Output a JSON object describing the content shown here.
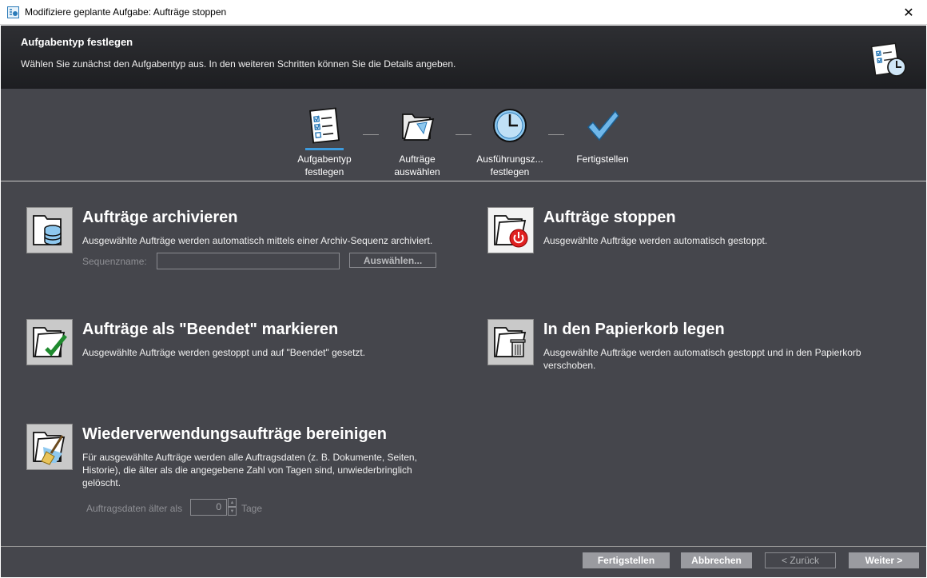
{
  "window": {
    "title": "Modifiziere geplante Aufgabe: Aufträge stoppen",
    "close_glyph": "✕"
  },
  "header": {
    "title": "Aufgabentyp festlegen",
    "subtitle": "Wählen Sie zunächst den Aufgabentyp aus. In den weiteren Schritten können Sie die Details angeben.",
    "icon": "scheduled-task-icon"
  },
  "steps": [
    {
      "label_line1": "Aufgabentyp",
      "label_line2": "festlegen",
      "icon": "checklist-icon",
      "active": true
    },
    {
      "label_line1": "Aufträge",
      "label_line2": "auswählen",
      "icon": "open-folder-icon",
      "active": false
    },
    {
      "label_line1": "Ausführungsz...",
      "label_line2": "festlegen",
      "icon": "clock-icon",
      "active": false
    },
    {
      "label_line1": "Fertigstellen",
      "label_line2": "",
      "icon": "checkmark-icon",
      "active": false
    }
  ],
  "options": {
    "archive": {
      "title": "Aufträge archivieren",
      "desc": "Ausgewählte Aufträge werden automatisch mittels einer Archiv-Sequenz archiviert.",
      "sequence_label": "Sequenzname:",
      "sequence_value": "",
      "select_button": "Auswählen..."
    },
    "stop": {
      "title": "Aufträge stoppen",
      "desc": "Ausgewählte Aufträge werden automatisch gestoppt.",
      "selected": true
    },
    "finished": {
      "title": "Aufträge als \"Beendet\" markieren",
      "desc": "Ausgewählte Aufträge werden gestoppt und auf \"Beendet\" gesetzt."
    },
    "trash": {
      "title": "In den Papierkorb legen",
      "desc_line1": "Ausgewählte Aufträge werden automatisch gestoppt und in den Papierkorb",
      "desc_line2": "verschoben."
    },
    "cleanup": {
      "title": "Wiederverwendungsaufträge bereinigen",
      "desc_line1": "Für ausgewählte Aufträge werden alle Auftragsdaten (z. B. Dokumente, Seiten,",
      "desc_line2": "Historie), die älter als die angegebene Zahl von Tagen sind, unwiederbringlich",
      "desc_line3": "gelöscht.",
      "days_label": "Auftragsdaten älter als",
      "days_value": "0",
      "days_unit": "Tage"
    }
  },
  "footer": {
    "finish": "Fertigstellen",
    "cancel": "Abbrechen",
    "back": "< Zurück",
    "next": "Weiter >"
  },
  "colors": {
    "panel_bg": "#45464c",
    "header_bg": "#1d1e21",
    "active_step": "#3d9bdd",
    "stop_red": "#e02020"
  }
}
